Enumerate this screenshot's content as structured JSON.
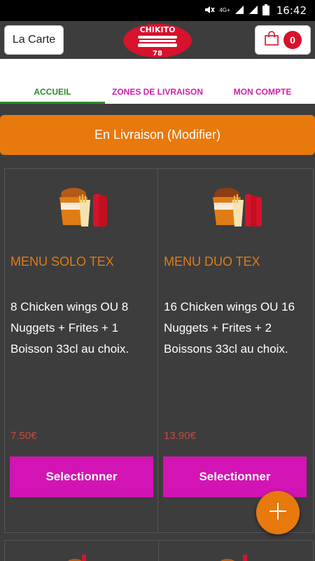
{
  "status": {
    "time": "16:42",
    "network": "4G+"
  },
  "header": {
    "carte_label": "La Carte",
    "logo_text": "CHIKITO",
    "logo_number": "78",
    "cart_count": "0"
  },
  "tabs": [
    {
      "label": "ACCUEIL",
      "active": true
    },
    {
      "label": "ZONES DE LIVRAISON",
      "active": false
    },
    {
      "label": "MON COMPTE",
      "active": false
    }
  ],
  "delivery": {
    "label": "En Livraison (Modifier)"
  },
  "products": [
    {
      "title": "MENU SOLO TEX",
      "description": "8 Chicken wings OU 8 Nuggets + Frites + 1 Boisson 33cl au choix.",
      "price": "7.50€",
      "button_label": "Selectionner"
    },
    {
      "title": "MENU DUO TEX",
      "description": "16 Chicken wings OU 16 Nuggets + Frites + 2 Boissons 33cl au choix.",
      "price": "13.90€",
      "button_label": "Selectionner"
    }
  ],
  "colors": {
    "accent_orange": "#e8790c",
    "select_magenta": "#d214b4",
    "tab_active_green": "#2c8a2a",
    "tab_inactive_pink": "#cf1fa9",
    "logo_red": "#d7122c"
  },
  "icons": [
    "mute-icon",
    "signal-icon",
    "battery-icon",
    "shopping-bag-icon",
    "plus-icon"
  ]
}
